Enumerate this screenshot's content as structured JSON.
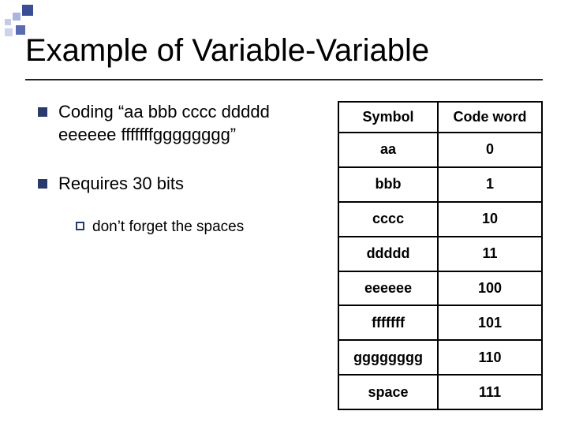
{
  "title": "Example of Variable-Variable",
  "bullets": {
    "b1a": "Coding “aa bbb cccc ddddd eeeeee fffffffgggggggg”",
    "b1b": "Requires 30 bits",
    "b2a": "don’t forget the spaces"
  },
  "table": {
    "headers": {
      "c0": "Symbol",
      "c1": "Code word"
    },
    "rows": [
      {
        "c0": "aa",
        "c1": "0"
      },
      {
        "c0": "bbb",
        "c1": "1"
      },
      {
        "c0": "cccc",
        "c1": "10"
      },
      {
        "c0": "ddddd",
        "c1": "11"
      },
      {
        "c0": "eeeeee",
        "c1": "100"
      },
      {
        "c0": "fffffff",
        "c1": "101"
      },
      {
        "c0": "gggggggg",
        "c1": "110"
      },
      {
        "c0": "space",
        "c1": "111"
      }
    ]
  }
}
